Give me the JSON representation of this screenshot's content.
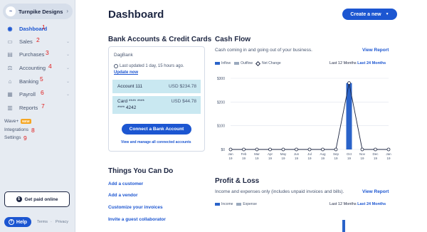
{
  "sidebar": {
    "business_name": "Turnpike Designs",
    "items": [
      {
        "label": "Dashboard",
        "icon": "dashboard-icon",
        "num": "1"
      },
      {
        "label": "Sales",
        "icon": "sales-icon",
        "num": "2"
      },
      {
        "label": "Purchases",
        "icon": "purchases-icon",
        "num": "3"
      },
      {
        "label": "Accounting",
        "icon": "accounting-icon",
        "num": "4"
      },
      {
        "label": "Banking",
        "icon": "banking-icon",
        "num": "5"
      },
      {
        "label": "Payroll",
        "icon": "payroll-icon",
        "num": "6"
      },
      {
        "label": "Reports",
        "icon": "reports-icon",
        "num": "7"
      }
    ],
    "wave_plus": "Wave+",
    "new_badge": "NEW",
    "integrations": "Integrations",
    "integrations_num": "8",
    "settings": "Settings",
    "settings_num": "9",
    "get_paid": "Get paid online",
    "help": "Help",
    "terms": "Terms",
    "privacy": "Privacy",
    "separator": "·"
  },
  "header": {
    "title": "Dashboard",
    "create_button": "Create a new"
  },
  "bank": {
    "heading": "Bank Accounts & Credit Cards",
    "bank_name": "DagBank",
    "last_updated": "Last updated 1 day, 15 hours ago.",
    "update_now": "Update now",
    "accounts": [
      {
        "name": "Account 111",
        "balance": "USD $234.78"
      },
      {
        "name_line1": "Card **** ****",
        "name_line2": "**** 4242",
        "balance": "USD $44.78"
      }
    ],
    "connect_button": "Connect a Bank Account",
    "view_manage": "View and manage all connected accounts"
  },
  "cashflow": {
    "heading": "Cash Flow",
    "subtitle": "Cash coming in and going out of your business.",
    "view_report": "View Report",
    "legend": {
      "inflow": "Inflow",
      "outflow": "Outflow",
      "net": "Net Change"
    },
    "period_selected": "Last 12 Months",
    "period_alt": "Last 24 Months",
    "colors": {
      "inflow": "#2a63c9",
      "outflow": "#9aa9bd",
      "net": "#1c2541"
    }
  },
  "chart_data": {
    "type": "bar",
    "categories": [
      "Jan 19",
      "Feb 19",
      "Mar 19",
      "Apr 19",
      "May 19",
      "Jun 19",
      "Jul 19",
      "Aug 19",
      "Sep 19",
      "Oct 19",
      "Nov 19",
      "Dec 19",
      "Jan 19"
    ],
    "x_tick_top": [
      "Jan",
      "Feb",
      "Mar",
      "Apr",
      "May",
      "Jun",
      "Jul",
      "Aug",
      "Sep",
      "Oct",
      "Nov",
      "Dec",
      "Jan"
    ],
    "x_tick_bottom": [
      "19",
      "19",
      "19",
      "19",
      "19",
      "19",
      "19",
      "19",
      "19",
      "19",
      "19",
      "19",
      "19"
    ],
    "series": [
      {
        "name": "Inflow",
        "values": [
          0,
          0,
          0,
          0,
          0,
          0,
          0,
          0,
          0,
          280,
          0,
          0,
          0
        ]
      },
      {
        "name": "Outflow",
        "values": [
          0,
          0,
          0,
          0,
          0,
          0,
          0,
          0,
          0,
          0,
          0,
          0,
          0
        ]
      },
      {
        "name": "Net Change",
        "values": [
          0,
          0,
          0,
          0,
          0,
          0,
          0,
          0,
          0,
          280,
          0,
          0,
          0
        ]
      }
    ],
    "yticks": [
      "$0",
      "$100",
      "$200",
      "$300"
    ],
    "ylim": [
      0,
      300
    ],
    "grid": true
  },
  "todo": {
    "heading": "Things You Can Do",
    "links": [
      "Add a customer",
      "Add a vendor",
      "Customize your invoices",
      "Invite a guest collaborator"
    ]
  },
  "profit": {
    "heading": "Profit & Loss",
    "subtitle": "Income and expenses only (includes unpaid invoices and bills).",
    "view_report": "View Report",
    "legend": {
      "income": "Income",
      "expense": "Expense"
    },
    "period_selected": "Last 12 Months",
    "period_alt": "Last 24 Months"
  }
}
